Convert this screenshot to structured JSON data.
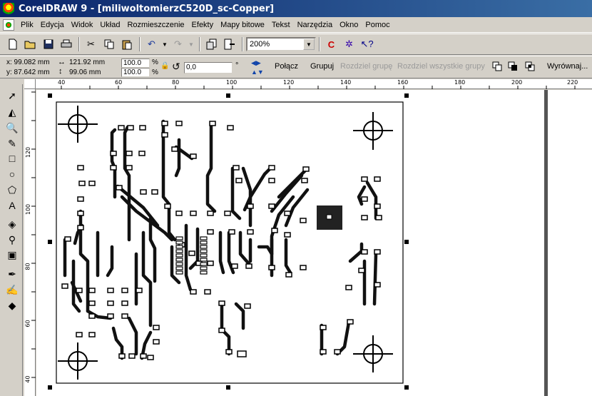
{
  "window": {
    "title": "CorelDRAW 9 - [miliwoltomierzC520D_sc-Copper]"
  },
  "menu": [
    "Plik",
    "Edycja",
    "Widok",
    "Układ",
    "Rozmieszczenie",
    "Efekty",
    "Mapy bitowe",
    "Tekst",
    "Narzędzia",
    "Okno",
    "Pomoc"
  ],
  "toolbar": {
    "zoom": "200%"
  },
  "properties": {
    "x": "x: 99.082 mm",
    "y": "y: 87.642 mm",
    "width": "121.92 mm",
    "height": "99.06 mm",
    "scale_x": "100.0",
    "scale_y": "100.0",
    "pct": "%",
    "angle": "0,0",
    "deg": "°",
    "combine": "Połącz",
    "group": "Grupuj",
    "ungroup": "Rozdziel grupę",
    "ungroup_all": "Rozdziel wszystkie grupy",
    "align": "Wyrównaj..."
  },
  "ruler": {
    "top_labels": [
      "40",
      "60",
      "80",
      "100",
      "120",
      "140",
      "160",
      "180",
      "200",
      "220"
    ],
    "left_labels": [
      "120",
      "100",
      "80",
      "60",
      "40"
    ]
  },
  "icons": {
    "new": "new-document-icon",
    "open": "open-folder-icon",
    "save": "save-icon",
    "print": "print-icon",
    "cut": "cut-icon",
    "copy": "copy-icon",
    "paste": "paste-icon",
    "undo": "undo-icon",
    "redo": "redo-icon"
  }
}
